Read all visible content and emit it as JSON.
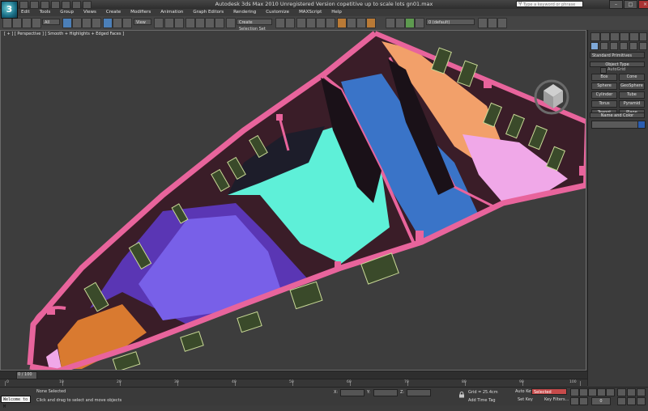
{
  "window": {
    "title": "Autodesk 3ds Max  2010     Unregistered Version     copetitive up to scale lots gn01.max",
    "search_placeholder": "Type a keyword or phrase"
  },
  "menu": {
    "items": [
      "Edit",
      "Tools",
      "Group",
      "Views",
      "Create",
      "Modifiers",
      "Animation",
      "Graph Editors",
      "Rendering",
      "Customize",
      "MAXScript",
      "Help"
    ]
  },
  "toolbar": {
    "filter_dropdown": "All",
    "view_dropdown": "View",
    "named_selection": "Create Selection Set",
    "layer_dropdown": "0 (default)"
  },
  "viewport": {
    "label": "[ + ] [ Perspective ] [ Smooth + Highlights + Edged Faces ]",
    "colors": {
      "walls": "#e8649c",
      "wall_dark": "#3a1d28",
      "floor_cyan": "#5ef0d8",
      "floor_blue": "#3a74c8",
      "floor_purple": "#7860e8",
      "floor_violet": "#5a36b4",
      "floor_orange": "#f2a06a",
      "floor_orange_dark": "#d97a30",
      "floor_pink": "#f0a8e8"
    }
  },
  "command_panel": {
    "category": "Standard Primitives",
    "object_type_title": "Object Type",
    "autogrid_label": "AutoGrid",
    "object_buttons": [
      "Box",
      "Cone",
      "Sphere",
      "GeoSphere",
      "Cylinder",
      "Tube",
      "Torus",
      "Pyramid",
      "Teapot",
      "Plane"
    ],
    "name_color_title": "Name and Color",
    "name_value": "",
    "object_color": "#2a5db0"
  },
  "timeline": {
    "frame_label": "0 / 100",
    "ticks": [
      "0",
      "10",
      "20",
      "30",
      "40",
      "50",
      "60",
      "70",
      "80",
      "90",
      "100"
    ]
  },
  "status": {
    "maxscript": "Welcome to M",
    "selection": "None Selected",
    "prompt": "Click and drag to select and move objects",
    "x_label": "X:",
    "y_label": "Y:",
    "z_label": "Z:",
    "grid": "Grid = 25.4cm",
    "add_time_tag": "Add Time Tag",
    "auto_key": "Auto Key",
    "selected_dropdown": "Selected",
    "set_key": "Set Key",
    "key_filters": "Key Filters...",
    "current_frame": "0"
  }
}
